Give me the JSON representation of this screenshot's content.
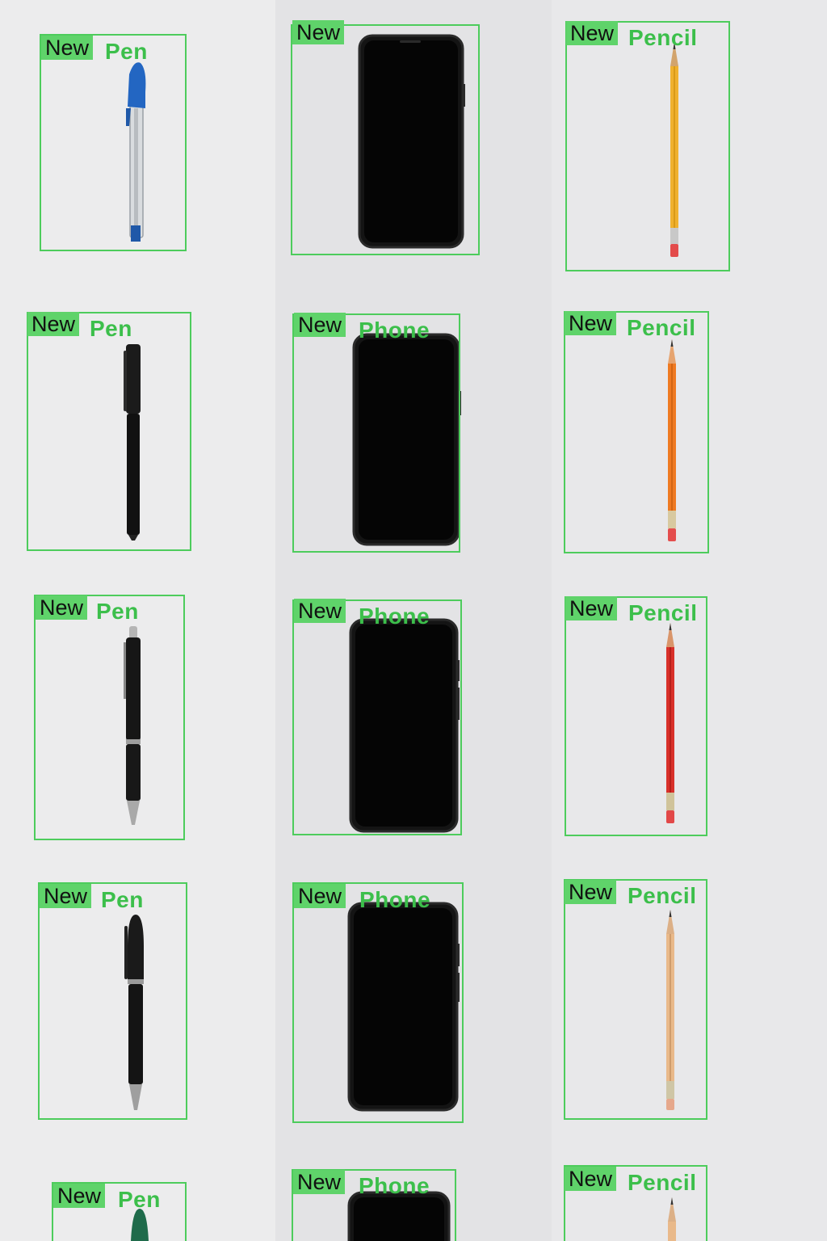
{
  "colors": {
    "box": "#4dcc5c",
    "tag_bg": "#5fd36a",
    "class_text": "#3cbf4b",
    "background": "#e6e6e7"
  },
  "detections": [
    {
      "tag": "New",
      "label": "Pen",
      "object": "blue-cap-ballpoint-pen"
    },
    {
      "tag": "New",
      "label": "",
      "object": "black-smartphone"
    },
    {
      "tag": "New",
      "label": "Pencil",
      "object": "yellow-pencil"
    },
    {
      "tag": "New",
      "label": "Pen",
      "object": "black-marker-pen"
    },
    {
      "tag": "New",
      "label": "Phone",
      "object": "black-smartphone"
    },
    {
      "tag": "New",
      "label": "Pencil",
      "object": "orange-pencil"
    },
    {
      "tag": "New",
      "label": "Pen",
      "object": "black-click-pen"
    },
    {
      "tag": "New",
      "label": "Phone",
      "object": "black-smartphone"
    },
    {
      "tag": "New",
      "label": "Pencil",
      "object": "red-pencil"
    },
    {
      "tag": "New",
      "label": "Pen",
      "object": "black-cap-pen"
    },
    {
      "tag": "New",
      "label": "Phone",
      "object": "black-smartphone"
    },
    {
      "tag": "New",
      "label": "Pencil",
      "object": "natural-wood-pencil"
    },
    {
      "tag": "New",
      "label": "Pen",
      "object": "green-cap-pen"
    },
    {
      "tag": "New",
      "label": "Phone",
      "object": "black-smartphone"
    },
    {
      "tag": "New",
      "label": "Pencil",
      "object": "wood-pencil"
    }
  ]
}
